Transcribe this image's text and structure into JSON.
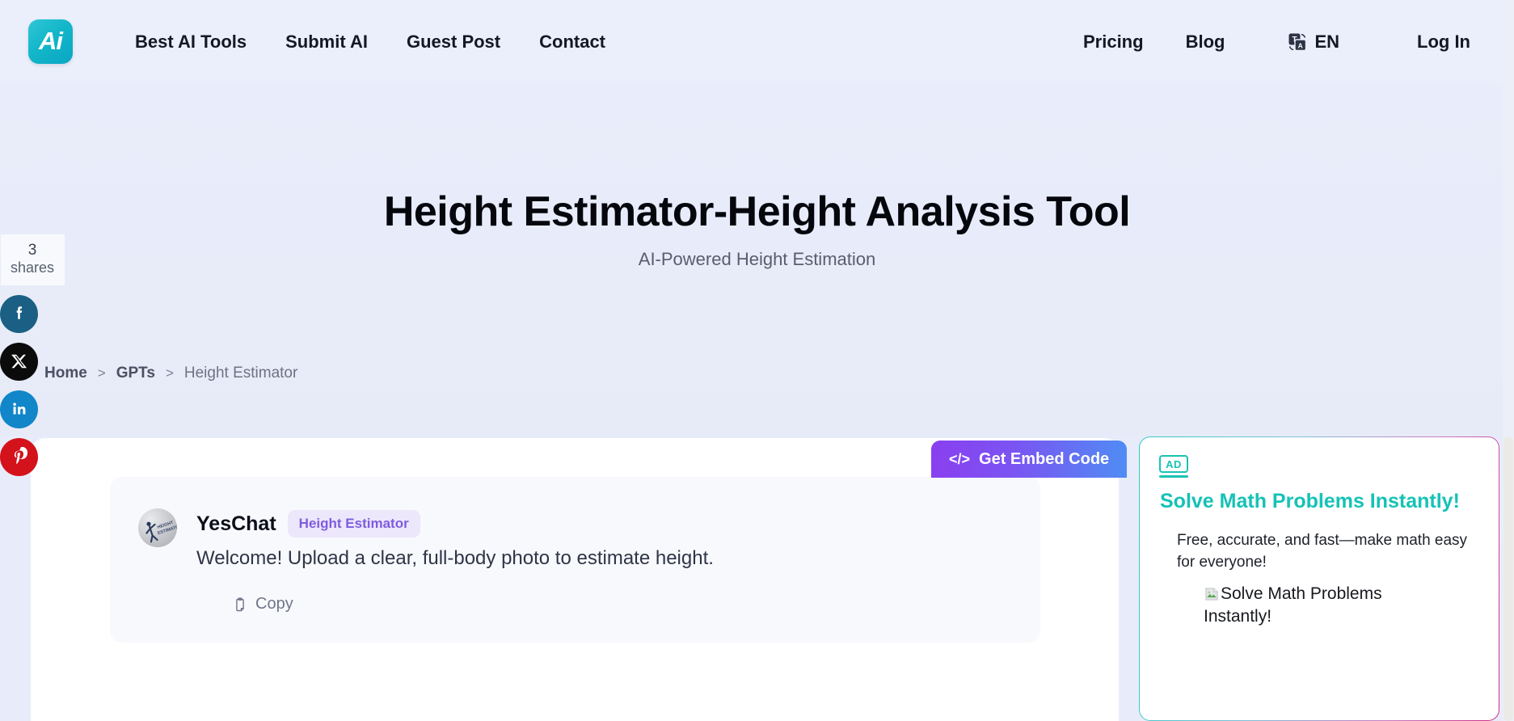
{
  "header": {
    "logo_alt": "Ai",
    "nav_left": [
      {
        "label": "Best AI Tools"
      },
      {
        "label": "Submit AI"
      },
      {
        "label": "Guest Post"
      },
      {
        "label": "Contact"
      }
    ],
    "nav_right": [
      {
        "label": "Pricing"
      },
      {
        "label": "Blog"
      }
    ],
    "language": {
      "label": "EN",
      "icon": "translate-icon"
    },
    "login_label": "Log In",
    "background_color": "#ebeefb"
  },
  "share_rail": {
    "count": "3",
    "count_label": "shares",
    "buttons": [
      {
        "name": "facebook",
        "icon": "facebook-icon",
        "color": "#1b5f85"
      },
      {
        "name": "x",
        "icon": "x-twitter-icon",
        "color": "#0b0b0b"
      },
      {
        "name": "linkedin",
        "icon": "linkedin-icon",
        "color": "#1186c8"
      },
      {
        "name": "pinterest",
        "icon": "pinterest-icon",
        "color": "#d4121b"
      }
    ]
  },
  "hero": {
    "title": "Height Estimator-Height Analysis Tool",
    "subtitle": "AI-Powered Height Estimation"
  },
  "breadcrumb": {
    "home": "Home",
    "sep1": ">",
    "gpts": "GPTs",
    "sep2": ">",
    "current": "Height Estimator"
  },
  "main": {
    "embed_button": {
      "label": "Get Embed Code",
      "icon": "code-icon"
    },
    "message": {
      "author": "YesChat",
      "badge": "Height Estimator",
      "text": "Welcome! Upload a clear, full-body photo to estimate height.",
      "copy_label": "Copy",
      "copy_icon": "clipboard-icon",
      "avatar_icon": "height-estimator-avatar"
    }
  },
  "ad": {
    "badge": "AD",
    "title": "Solve Math Problems Instantly!",
    "description": "Free, accurate, and fast—make math easy for everyone!",
    "image_alt": "Solve Math Problems Instantly!",
    "accent_color": "#16c2b6"
  }
}
